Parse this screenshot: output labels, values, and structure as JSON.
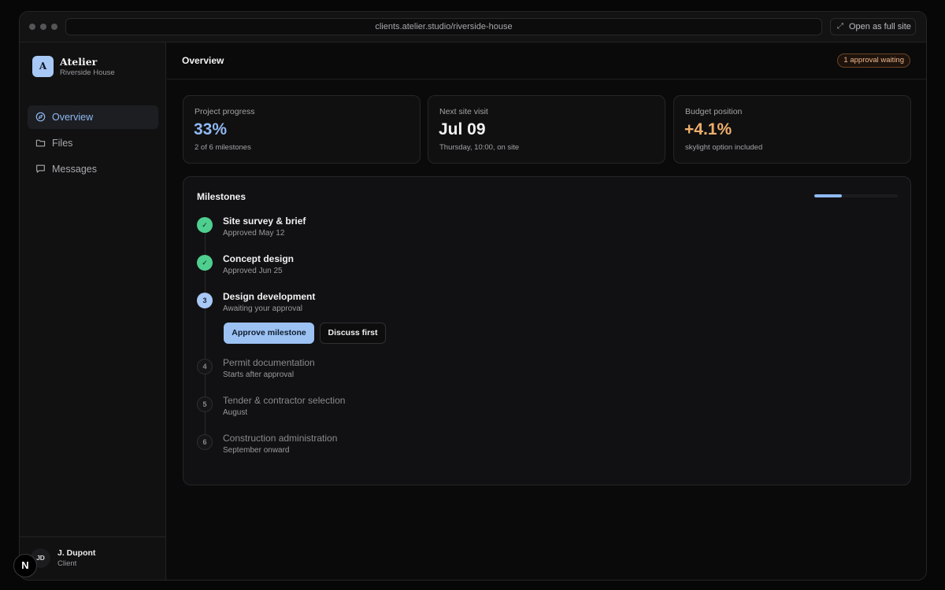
{
  "browser": {
    "url": "clients.atelier.studio/riverside-house",
    "open_full_site_label": "Open as full site"
  },
  "brand": {
    "logo_letter": "A",
    "name": "Atelier",
    "project": "Riverside House"
  },
  "sidebar": {
    "items": [
      {
        "label": "Overview",
        "icon": "compass-icon",
        "active": true
      },
      {
        "label": "Files",
        "icon": "folder-icon",
        "active": false
      },
      {
        "label": "Messages",
        "icon": "message-icon",
        "active": false
      }
    ]
  },
  "user": {
    "initials": "JD",
    "name": "J. Dupont",
    "role": "Client"
  },
  "header": {
    "title": "Overview",
    "badge": "1 approval waiting"
  },
  "stats": [
    {
      "label": "Project progress",
      "value": "33%",
      "sub": "2 of 6 milestones",
      "color": "#8fb9f2"
    },
    {
      "label": "Next site visit",
      "value": "Jul 09",
      "sub": "Thursday, 10:00, on site",
      "color": "#f2f2f2"
    },
    {
      "label": "Budget position",
      "value": "+4.1%",
      "sub": "skylight option included",
      "color": "#eeaf6c"
    }
  ],
  "milestones": {
    "title": "Milestones",
    "progress_fraction": 0.33,
    "items": [
      {
        "marker": "✓",
        "name": "Site survey & brief",
        "status": "Approved May 12",
        "state": "done"
      },
      {
        "marker": "✓",
        "name": "Concept design",
        "status": "Approved Jun 25",
        "state": "done"
      },
      {
        "marker": "3",
        "name": "Design development",
        "status": "Awaiting your approval",
        "state": "current"
      },
      {
        "marker": "4",
        "name": "Permit documentation",
        "status": "Starts after approval",
        "state": "upcoming"
      },
      {
        "marker": "5",
        "name": "Tender & contractor selection",
        "status": "August",
        "state": "upcoming"
      },
      {
        "marker": "6",
        "name": "Construction administration",
        "status": "September onward",
        "state": "upcoming"
      }
    ],
    "approve_label": "Approve milestone",
    "discuss_label": "Discuss first"
  },
  "fab": {
    "letter": "N"
  },
  "colors": {
    "accent": "#8fb9f2",
    "success": "#4fcf8f",
    "warning": "#eeaf6c"
  }
}
